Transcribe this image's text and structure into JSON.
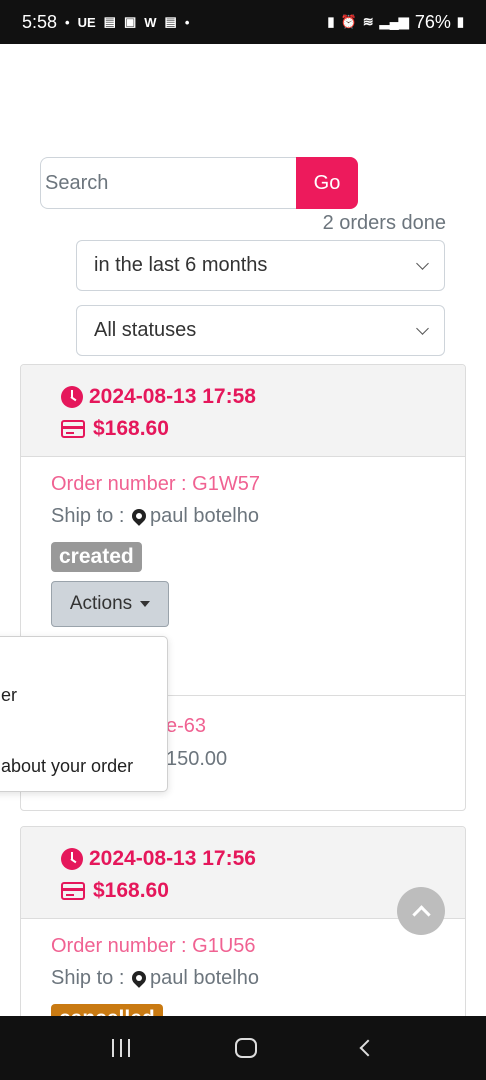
{
  "status_bar": {
    "time": "5:58",
    "left_icons": [
      "•",
      "UE",
      "▤",
      "▣",
      "W",
      "▤",
      "•"
    ],
    "right_icons": [
      "battery-saver-icon",
      "alarm-icon",
      "wifi-icon",
      "signal-icon"
    ],
    "battery": "76%"
  },
  "search": {
    "placeholder": "Search",
    "go_label": "Go",
    "orders_done": "2 orders done"
  },
  "filters": {
    "period": "in the last 6 months",
    "status": "All statuses"
  },
  "orders": [
    {
      "datetime": "2024-08-13 17:58",
      "total": "$168.60",
      "order_number": "Order number : G1W57",
      "ship_to_label": "Ship to :",
      "ship_to_name": "paul botelho",
      "status": "created",
      "status_color": "#999999",
      "actions_label": "Actions",
      "sub_line_1": "e-63",
      "sub_line_2": "150.00"
    },
    {
      "datetime": "2024-08-13 17:56",
      "total": "$168.60",
      "order_number": "Order number : G1U56",
      "ship_to_label": "Ship to :",
      "ship_to_name": "paul botelho",
      "status": "cancelled",
      "status_color": "#c97a12"
    }
  ],
  "actions_menu": {
    "items": [
      "er",
      "about your order"
    ]
  },
  "colors": {
    "accent": "#ed1a5c",
    "link_pink": "#f06292"
  }
}
